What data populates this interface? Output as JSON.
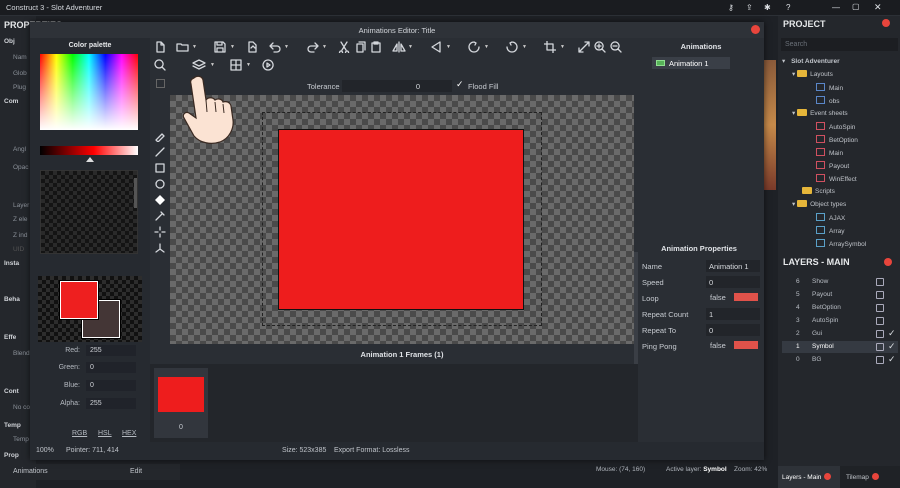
{
  "app": {
    "title": "Construct 3 - Slot Adventurer"
  },
  "properties_panel": {
    "header": "PROPERTIES",
    "rows": [
      "Obj",
      "Nam",
      "Glob",
      "Plug",
      "Com",
      "Angl",
      "Opac",
      "Layer",
      "Z ele",
      "Z ind",
      "UID",
      "Insta",
      "Beha",
      "Effe",
      "Blend",
      "Cont",
      "No co",
      "Temp",
      "Temp",
      "Prop"
    ],
    "footer": {
      "label": "Animations",
      "value": "Edit"
    }
  },
  "editor": {
    "title": "Animations Editor: Title",
    "palette": {
      "header": "Color palette",
      "red_label": "Red:",
      "red": "255",
      "green_label": "Green:",
      "green": "0",
      "blue_label": "Blue:",
      "blue": "0",
      "alpha_label": "Alpha:",
      "alpha": "255",
      "formats": [
        "RGB",
        "HSL",
        "HEX"
      ],
      "primary_color": "#ee1f1f",
      "secondary_color": "#443636"
    },
    "toolbar": {
      "tolerance_label": "Tolerance",
      "tolerance_value": "0",
      "flood_fill_label": "Flood Fill"
    },
    "frames": {
      "header": "Animation 1 Frames (1)",
      "items": [
        {
          "index": "0",
          "color": "#ee1d1d"
        }
      ]
    },
    "animations": {
      "header": "Animations",
      "items": [
        "Animation 1"
      ]
    },
    "animation_properties": {
      "header": "Animation Properties",
      "rows": [
        {
          "key": "Name",
          "value": "Animation 1"
        },
        {
          "key": "Speed",
          "value": "0"
        },
        {
          "key": "Loop",
          "value": "false"
        },
        {
          "key": "Repeat Count",
          "value": "1"
        },
        {
          "key": "Repeat To",
          "value": "0"
        },
        {
          "key": "Ping Pong",
          "value": "false"
        }
      ]
    },
    "status": {
      "zoom": "100%",
      "pointer": "Pointer: 711, 414",
      "size": "Size: 523x385",
      "export": "Export Format: Lossless"
    }
  },
  "project": {
    "header": "PROJECT",
    "search_placeholder": "Search",
    "root": "Slot Adventurer",
    "layouts_label": "Layouts",
    "layouts": [
      "Main",
      "obs"
    ],
    "event_sheets_label": "Event sheets",
    "event_sheets": [
      "AutoSpin",
      "BetOption",
      "Main",
      "Payout",
      "WinEffect"
    ],
    "scripts_label": "Scripts",
    "object_types_label": "Object types",
    "object_types": [
      "AJAX",
      "Array",
      "ArraySymbol"
    ]
  },
  "layers": {
    "header": "LAYERS - MAIN",
    "items": [
      {
        "n": "6",
        "name": "Show"
      },
      {
        "n": "5",
        "name": "Payout"
      },
      {
        "n": "4",
        "name": "BetOption"
      },
      {
        "n": "3",
        "name": "AutoSpin"
      },
      {
        "n": "2",
        "name": "Gui"
      },
      {
        "n": "1",
        "name": "Symbol"
      },
      {
        "n": "0",
        "name": "BG"
      }
    ]
  },
  "status_bar": {
    "mouse": "Mouse: (74, 160)",
    "active_layer_label": "Active layer:",
    "active_layer": "Symbol",
    "zoom": "Zoom: 42%"
  },
  "bottom_tabs": [
    "Layers - Main",
    "Tilemap"
  ]
}
